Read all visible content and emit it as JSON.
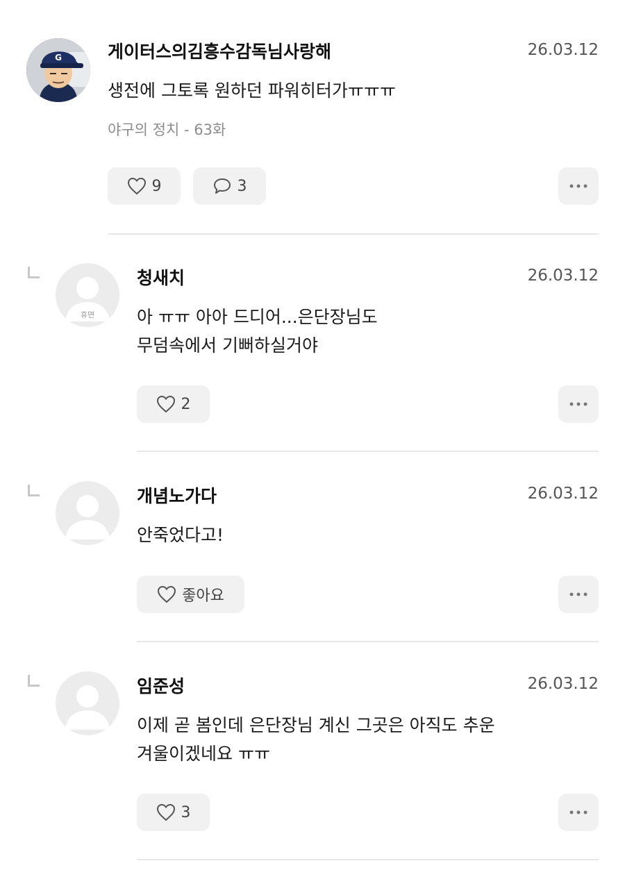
{
  "comments": [
    {
      "username": "게이터스의김흥수감독님사랑해",
      "date": "26.03.12",
      "text": "생전에 그토록 원하던 파워히터가ㅠㅠㅠ",
      "episode": "야구의 정치 - 63화",
      "likes": "9",
      "replies": "3",
      "avatar": "manager-photo"
    },
    {
      "username": "청새치",
      "date": "26.03.12",
      "text": "아 ㅠㅠ 아아  드디어...은단장님도\n무덤속에서 기뻐하실거야",
      "likes": "2",
      "avatar_badge": "휴면"
    },
    {
      "username": "개념노가다",
      "date": "26.03.12",
      "text": "안죽었다고!",
      "likes": "좋아요"
    },
    {
      "username": "임준성",
      "date": "26.03.12",
      "text": "이제 곧 봄인데 은단장님 계신 그곳은 아직도 추운\n겨울이겠네요 ㅠㅠ",
      "likes": "3"
    }
  ],
  "icons": {
    "like": "heart-outline-icon",
    "reply": "speech-bubble-icon",
    "more": "more-dots-icon",
    "reply_indicator": "reply-corner-icon"
  },
  "colors": {
    "button_bg": "#f1f1f1",
    "divider": "#e8e8e8",
    "meta_text": "#8c8c8c"
  }
}
